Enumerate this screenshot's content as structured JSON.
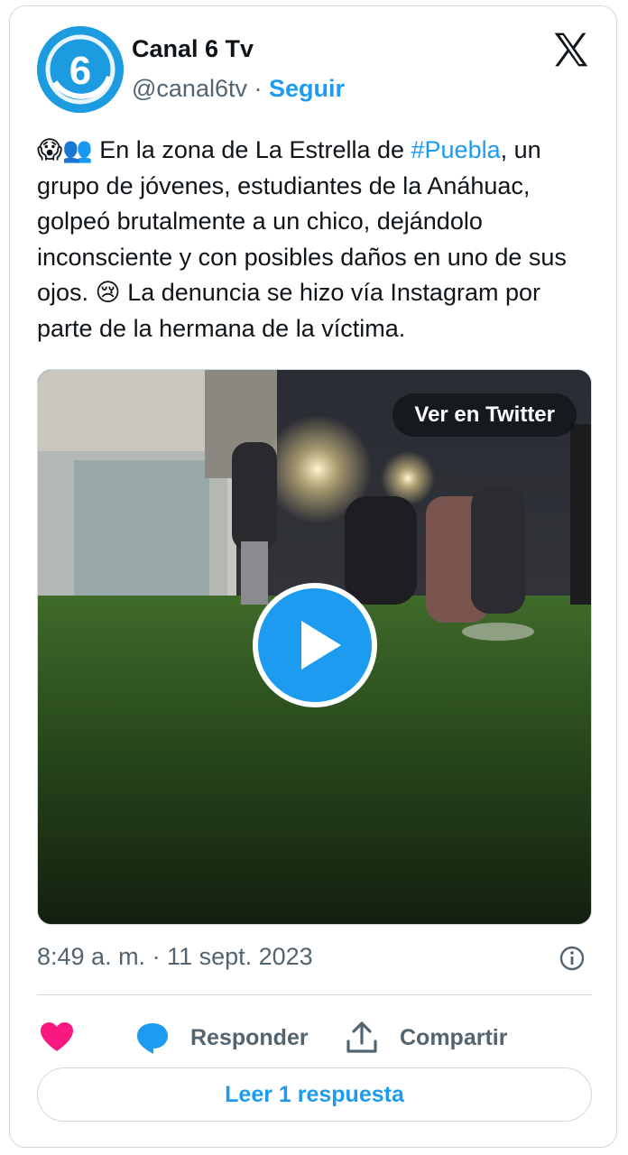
{
  "author": {
    "name": "Canal 6 Tv",
    "handle": "@canal6tv",
    "separator": "·",
    "follow_label": "Seguir",
    "avatar_text": "6"
  },
  "tweet": {
    "text_before": "En la zona de La Estrella de ",
    "hashtag": "#Puebla",
    "text_middle": ", un grupo de jóvenes, estudiantes de la Anáhuac, golpeó brutalmente a un chico, dejándolo inconsciente y con posibles daños en uno de sus ojos. ",
    "text_after": " La denuncia se hizo vía Instagram por parte de la hermana de la víctima.",
    "emoji_lead": "😱👥",
    "emoji_mid": "😢"
  },
  "media": {
    "view_on_twitter_label": "Ver en Twitter"
  },
  "timestamp": "8:49 a. m. · 11 sept. 2023",
  "actions": {
    "reply_label": "Responder",
    "share_label": "Compartir"
  },
  "read_replies_label": "Leer 1 respuesta",
  "colors": {
    "accent": "#1d9bf0",
    "like": "#f91880",
    "muted": "#536471",
    "border": "#cfd9de"
  }
}
